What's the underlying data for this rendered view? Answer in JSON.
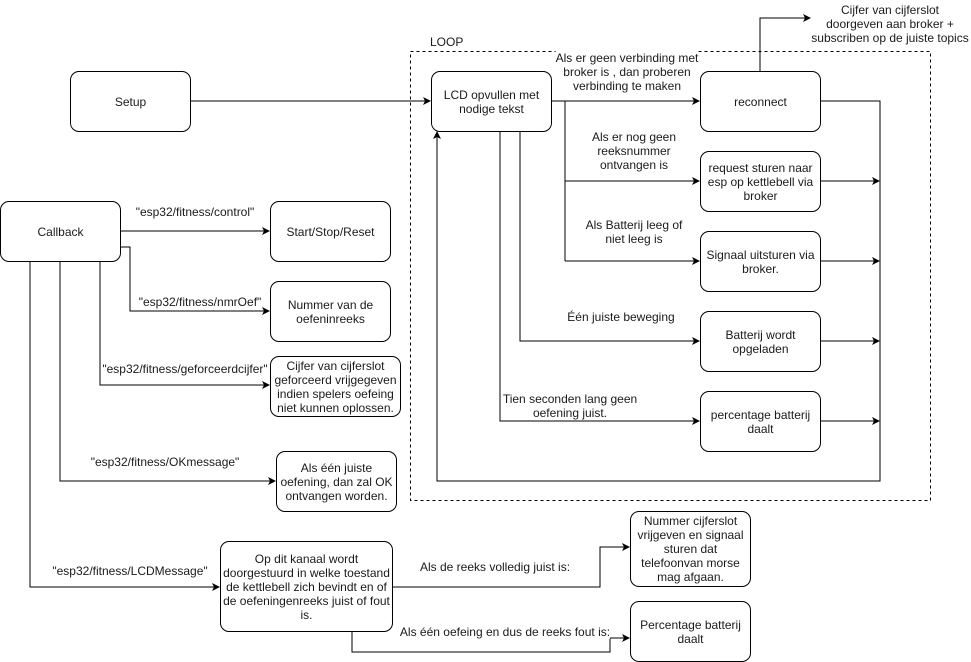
{
  "loop": {
    "title": "LOOP"
  },
  "nodes": {
    "setup": "Setup",
    "lcd": "LCD opvullen met\nnodige tekst",
    "reconnect": "reconnect",
    "request": "request sturen naar\nesp op kettlebell via\nbroker",
    "signaal": "Signaal uitsturen via\nbroker.",
    "batterij_op": "Batterij wordt\nopgeladen",
    "batterij_daalt": "percentage batterij\ndaalt",
    "callback": "Callback",
    "startstop": "Start/Stop/Reset",
    "nummer": "Nummer van de\noefeninreeks",
    "cijfer": "Cijfer van cijferslot\ngeforceerd vrijgegeven\nindien spelers oefeing\nniet kunnen oplossen.",
    "ok": "Als één juiste\noefening, dan zal OK\nontvangen worden.",
    "lcdmessage": "Op dit kanaal wordt\ndoorgestuurd in welke toestand\nde kettlebell zich bevindt en of\nde oefeningenreeks juist of fout\nis.",
    "vrijgeven": "Nummer cijferslot\nvrijgeven en signaal\nsturen dat\ntelefoonvan morse\nmag afgaan.",
    "percentage": "Percentage batterij\ndaalt"
  },
  "labels": {
    "publish": "Cijfer van cijferslot\ndoorgeven aan broker +\nsubscriben op de juiste topics",
    "geen_verbinding": "Als er geen verbinding met\nbroker is , dan proberen\nverbinding te maken",
    "geen_reeks": "Als er nog geen\nreeksnummer\nontvangen is",
    "batterij_leeg": "Als Batterij leeg of\nniet leeg is",
    "juiste_beweging": "Één juiste beweging",
    "tien_seconden": "Tien seconden lang geen\noefening juist.",
    "topic_control": "\"esp32/fitness/control\"",
    "topic_nmroef": "\"esp32/fitness/nmrOef\"",
    "topic_geforceerd": "\"esp32/fitness/geforceerdcijfer\"",
    "topic_ok": "\"esp32/fitness/OKmessage\"",
    "topic_lcd": "\"esp32/fitness/LCDMessage\"",
    "reeks_juist": "Als de reeks volledig juist is:",
    "reeks_fout": "Als één oefeing en dus de reeks fout is:"
  }
}
